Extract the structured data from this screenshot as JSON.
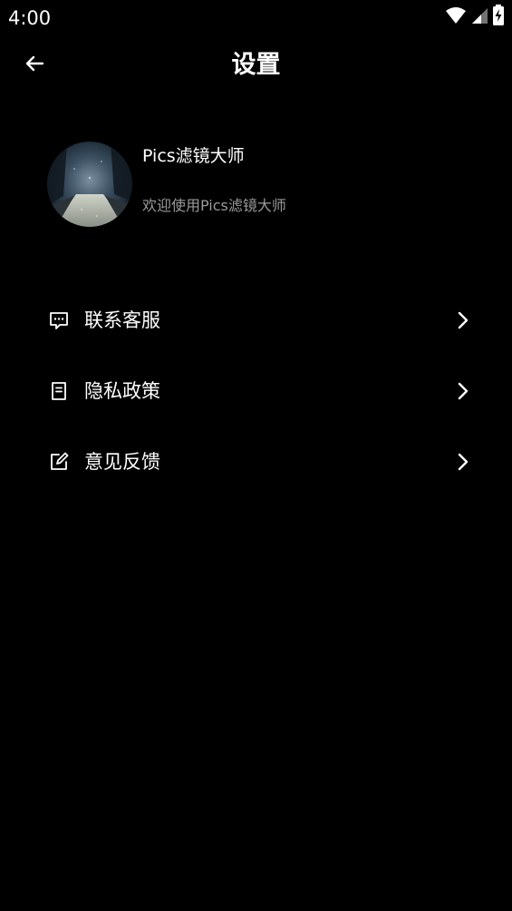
{
  "status_bar": {
    "time": "4:00",
    "icons": [
      "wifi-icon",
      "cell-signal-icon",
      "battery-charging-icon"
    ]
  },
  "header": {
    "title": "设置",
    "back_icon": "arrow-left-icon"
  },
  "profile": {
    "name": "Pics滤镜大师",
    "subtitle": "欢迎使用Pics滤镜大师",
    "avatar": "forest-night-photo"
  },
  "menu": {
    "items": [
      {
        "label": "联系客服",
        "icon": "chat-bubble-icon"
      },
      {
        "label": "隐私政策",
        "icon": "document-icon"
      },
      {
        "label": "意见反馈",
        "icon": "edit-icon"
      }
    ],
    "chevron_icon": "chevron-right-icon"
  },
  "colors": {
    "background": "#000000",
    "text_primary": "#ffffff",
    "text_secondary": "#9a9a9a"
  }
}
